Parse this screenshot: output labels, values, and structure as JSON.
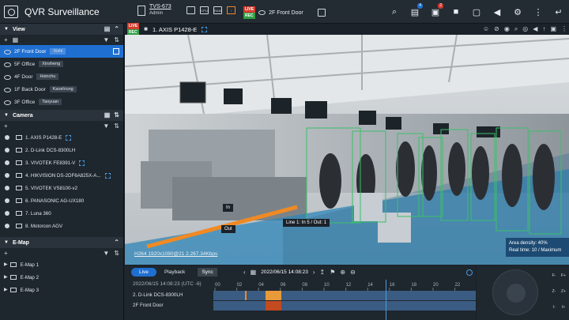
{
  "app": {
    "title": "QVR Surveillance"
  },
  "server": {
    "name": "TVS-673",
    "user": "Admin"
  },
  "system_icons": [
    {
      "icon": "monitor-icon",
      "label": ""
    },
    {
      "icon": "cpu-icon",
      "label": "CPU"
    },
    {
      "icon": "ram-icon",
      "label": "RAM"
    },
    {
      "icon": "warning-icon",
      "label": ""
    }
  ],
  "toolbar": {
    "live_badge": "LIVE",
    "rec_badge": "REC",
    "current_view": "2F Front Door",
    "buttons": [
      {
        "icon": "search-icon",
        "count": ""
      },
      {
        "icon": "notification-icon",
        "count": "4"
      },
      {
        "icon": "alert-icon",
        "count": "2"
      },
      {
        "icon": "camera-icon",
        "count": ""
      },
      {
        "icon": "fullscreen-icon",
        "count": ""
      },
      {
        "icon": "volume-icon",
        "count": ""
      },
      {
        "icon": "settings-icon",
        "count": ""
      },
      {
        "icon": "more-icon",
        "count": ""
      },
      {
        "icon": "logout-icon",
        "count": ""
      }
    ]
  },
  "view_panel": {
    "title": "View",
    "items": [
      {
        "label": "2F Front Door",
        "tag": "Xizhi",
        "active": true
      },
      {
        "label": "5F Office",
        "tag": "Xinsheng",
        "active": false
      },
      {
        "label": "4F Door",
        "tag": "Hsinchu",
        "active": false
      },
      {
        "label": "1F Back Door",
        "tag": "Kaoshiung",
        "active": false
      },
      {
        "label": "3F Office",
        "tag": "Taoyuan",
        "active": false
      }
    ]
  },
  "camera_panel": {
    "title": "Camera",
    "items": [
      {
        "label": "1. AXIS P1428-E",
        "ptz": true
      },
      {
        "label": "2. D-Link DCS-8300LH",
        "ptz": false
      },
      {
        "label": "3. VIVOTEK FE8391-V",
        "ptz": true
      },
      {
        "label": "4. HIKVISION DS-2DF6A825X-A...",
        "ptz": true
      },
      {
        "label": "5. VIVOTEK VS8100-v2",
        "ptz": false
      },
      {
        "label": "6. PANASONIC AG-UX180",
        "ptz": false
      },
      {
        "label": "7. Luna 360",
        "ptz": false
      },
      {
        "label": "8. Motorcon AGV",
        "ptz": false
      }
    ]
  },
  "emap_panel": {
    "title": "E-Map",
    "items": [
      "E-Map 1",
      "E-Map 2",
      "E-Map 3"
    ]
  },
  "video": {
    "live_badge": "LIVE",
    "rec_badge": "REC",
    "title": "1. AXIS P1428-E",
    "stream_info": "H264 1920x1080@21 2.267.34Kbps",
    "in_label": "In",
    "out_label": "Out",
    "line_counter": "Line 1: In 5 / Out: 1",
    "area_density": "Area density: 40%",
    "real_time": "Real time: 10 / Maximum",
    "colors": {
      "line": "#f08a24",
      "zone": "#2f86b8",
      "box": "#3cbf6a"
    }
  },
  "timeline": {
    "tabs": [
      "Live",
      "Playback"
    ],
    "sync_label": "Sync",
    "date": "2022/06/15 14:08:23",
    "stamp": "2022/06/15 14:08:23 (UTC -6)",
    "hours": [
      "00",
      "02",
      "04",
      "06",
      "08",
      "10",
      "12",
      "14",
      "16",
      "18",
      "20",
      "22"
    ],
    "rows": [
      "2. D-Link DCS-8300LH",
      "2F Front Door"
    ]
  },
  "ptz_pad": {
    "buttons": [
      "F-",
      "F+",
      "Z-",
      "Z+",
      "I-",
      "I+"
    ]
  }
}
